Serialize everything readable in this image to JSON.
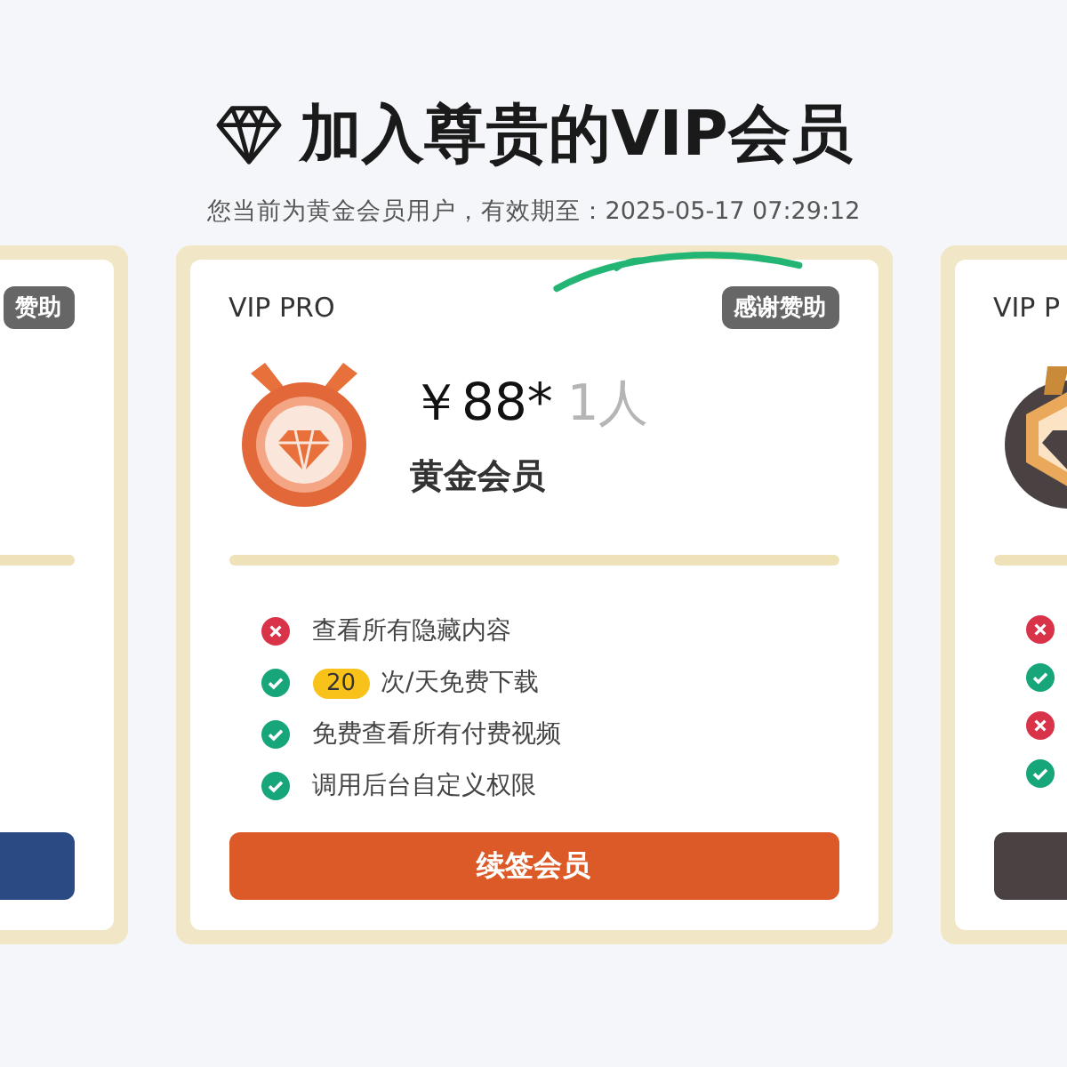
{
  "header": {
    "title": "加入尊贵的VIP会员",
    "subtitle": "您当前为黄金会员用户，有效期至：2025-05-17 07:29:12"
  },
  "cards": [
    {
      "badge": "赞助",
      "button": {
        "color": "#2b4a84"
      }
    },
    {
      "tier": "VIP PRO",
      "badge": "感谢赞助",
      "medal": {
        "kind": "round"
      },
      "price": "￥88*",
      "unit": "1人",
      "level_name": "黄金会员",
      "features": [
        {
          "included": false,
          "text": "查看所有隐藏内容"
        },
        {
          "included": true,
          "count": "20",
          "text": "次/天免费下载"
        },
        {
          "included": true,
          "text": "免费查看所有付费视频"
        },
        {
          "included": true,
          "text": "调用后台自定义权限"
        }
      ],
      "button": {
        "label": "续签会员",
        "color": "#dc5a27"
      }
    },
    {
      "tier": "VIP P",
      "medal": {
        "kind": "hexagon"
      },
      "features": [
        {
          "included": false
        },
        {
          "included": true
        },
        {
          "included": false
        },
        {
          "included": true
        }
      ],
      "button": {
        "color": "#4a4242"
      }
    }
  ]
}
